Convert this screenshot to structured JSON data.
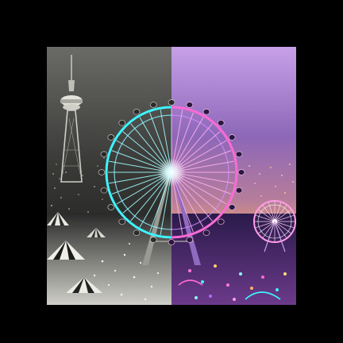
{
  "image": {
    "subject": "ferris-wheel-split-scene",
    "left_half": "monochrome",
    "right_half": "neon-color",
    "colors": {
      "background": "#000000",
      "left_sky_top": "#5e5e5c",
      "left_sky_bottom": "#1b1b1b",
      "right_sky_top": "#c99ae6",
      "right_sky_mid": "#7a5aa8",
      "right_sky_horizon": "#f2a26a",
      "neon_cyan": "#38f5ff",
      "neon_pink": "#ff6ad5",
      "neon_violet": "#b06bff"
    }
  }
}
